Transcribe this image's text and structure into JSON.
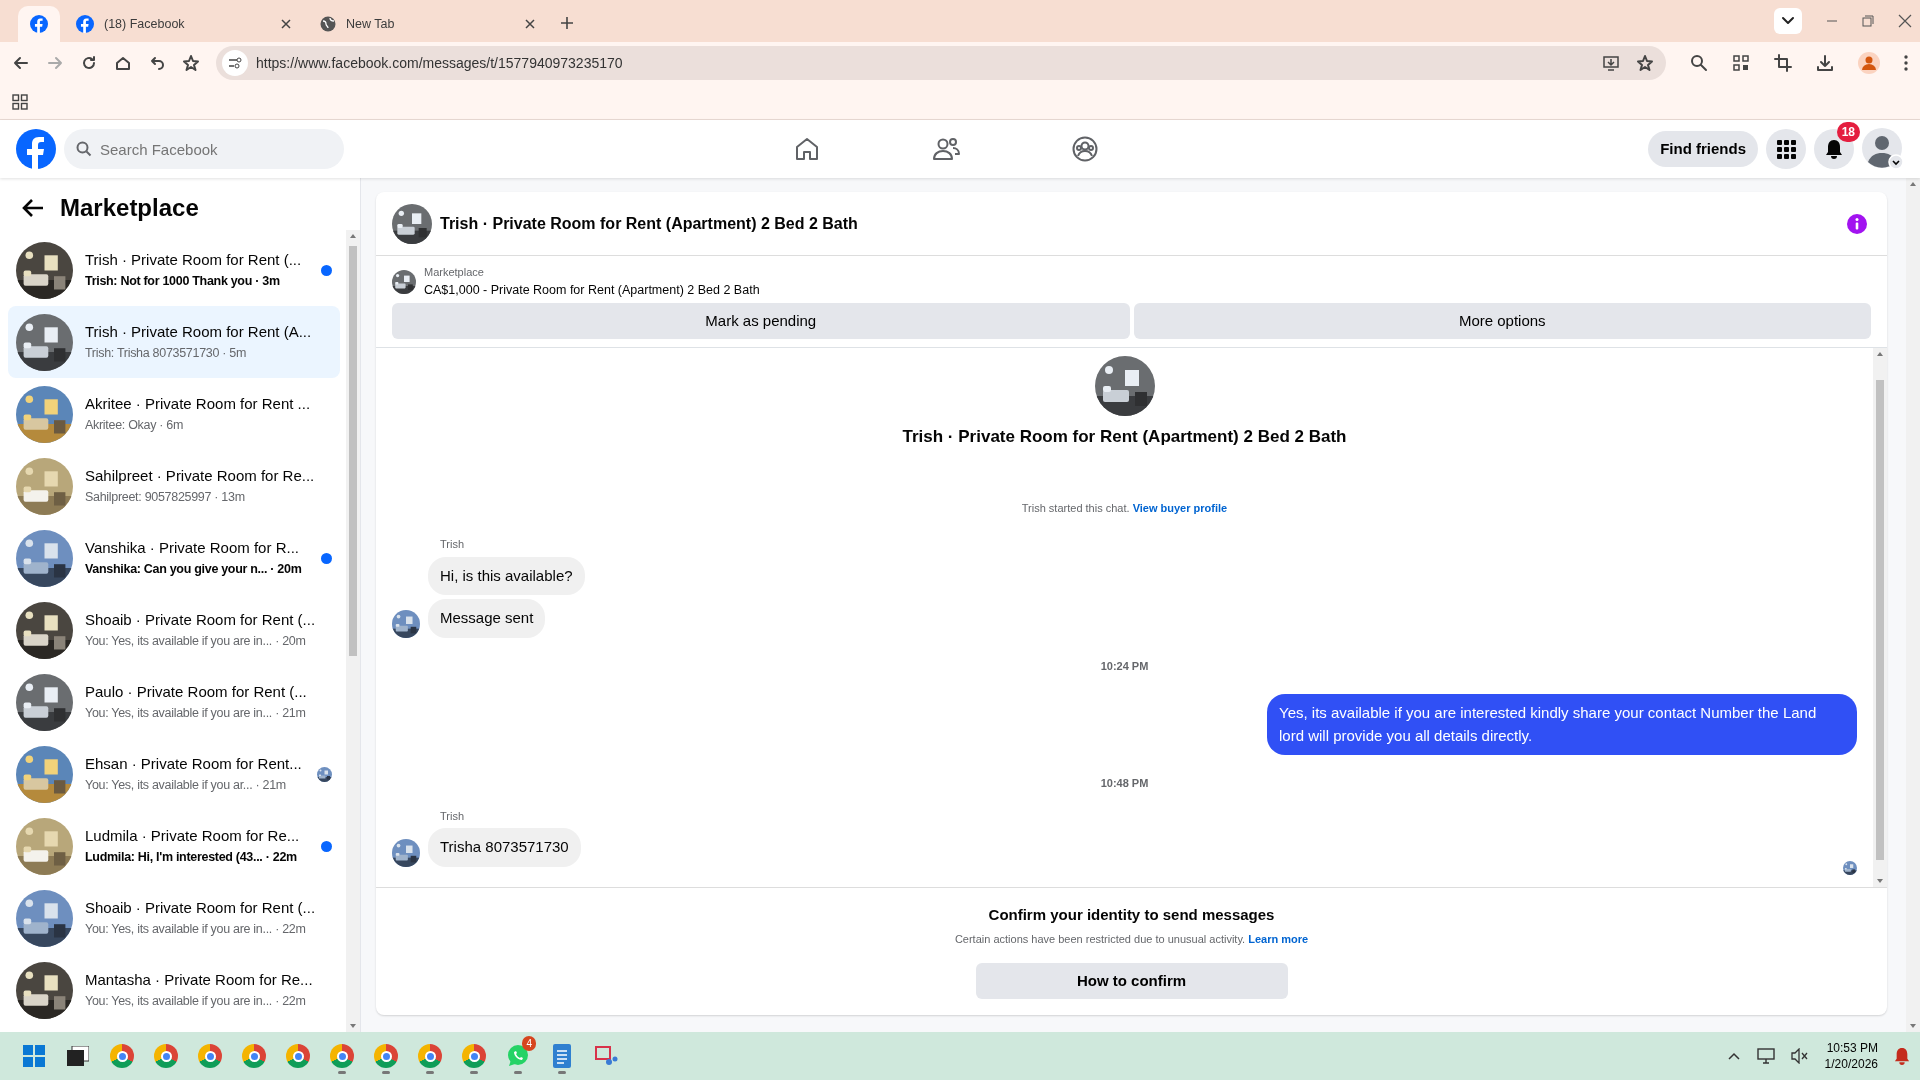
{
  "browser": {
    "tabs": [
      {
        "kind": "pinned",
        "selected": true
      },
      {
        "kind": "normal",
        "title": "(18) Facebook",
        "selected": false
      },
      {
        "kind": "normal",
        "title": "New Tab",
        "selected": false
      }
    ],
    "url": "https://www.facebook.com/messages/t/1577940973235170"
  },
  "header": {
    "search": {
      "placeholder": "Search Facebook"
    },
    "find_friends": "Find friends",
    "notifications": "18"
  },
  "sidebar": {
    "title": "Marketplace",
    "conversations": [
      {
        "title": "Trish · Private Room for Rent (...",
        "preview": "Trish: Not for 1000 Thank you",
        "time": "· 3m",
        "unread": true,
        "seen": false,
        "selected": false
      },
      {
        "title": "Trish · Private Room for Rent (A...",
        "preview": "Trish: Trisha 8073571730",
        "time": "· 5m",
        "unread": false,
        "seen": false,
        "selected": true
      },
      {
        "title": "Akritee · Private Room for Rent ...",
        "preview": "Akritee: Okay",
        "time": "· 6m",
        "unread": false,
        "seen": false,
        "selected": false
      },
      {
        "title": "Sahilpreet · Private Room for Re...",
        "preview": "Sahilpreet: 9057825997",
        "time": "· 13m",
        "unread": false,
        "seen": false,
        "selected": false
      },
      {
        "title": "Vanshika · Private Room for R...",
        "preview": "Vanshika: Can you give your n...",
        "time": "· 20m",
        "unread": true,
        "seen": false,
        "selected": false
      },
      {
        "title": "Shoaib · Private Room for Rent (...",
        "preview": "You: Yes, its available if you are in...",
        "time": "· 20m",
        "unread": false,
        "seen": false,
        "selected": false
      },
      {
        "title": "Paulo · Private Room for Rent (...",
        "preview": "You: Yes, its available if you are in...",
        "time": "· 21m",
        "unread": false,
        "seen": false,
        "selected": false
      },
      {
        "title": "Ehsan · Private Room for Rent...",
        "preview": "You: Yes, its available if you ar...",
        "time": "· 21m",
        "unread": false,
        "seen": true,
        "selected": false
      },
      {
        "title": "Ludmila · Private Room for Re...",
        "preview": "Ludmila: Hi, I'm interested (43...",
        "time": "· 22m",
        "unread": true,
        "seen": false,
        "selected": false
      },
      {
        "title": "Shoaib · Private Room for Rent (...",
        "preview": "You: Yes, its available if you are in...",
        "time": "· 22m",
        "unread": false,
        "seen": false,
        "selected": false
      },
      {
        "title": "Mantasha · Private Room for Re...",
        "preview": "You: Yes, its available if you are in...",
        "time": "· 22m",
        "unread": false,
        "seen": false,
        "selected": false
      }
    ]
  },
  "chat": {
    "title": "Trish · Private Room for Rent (Apartment) 2 Bed 2 Bath",
    "listing": {
      "label": "Marketplace",
      "text": "CA$1,000 - Private Room for Rent (Apartment) 2 Bed 2 Bath",
      "buttons": [
        "Mark as pending",
        "More options"
      ]
    },
    "profile_title": "Trish · Private Room for Rent (Apartment) 2 Bed 2 Bath",
    "started": {
      "text": "Trish started this chat.",
      "link": "View buyer profile"
    },
    "messages": [
      {
        "kind": "sender",
        "text": "Trish"
      },
      {
        "kind": "incoming",
        "text": "Hi, is this available?",
        "avatar": false
      },
      {
        "kind": "incoming",
        "text": "Message sent",
        "avatar": true
      },
      {
        "kind": "time",
        "text": "10:24 PM"
      },
      {
        "kind": "outgoing",
        "text": "Yes, its available if you are interested kindly share your contact Number the Land lord will provide you all details directly."
      },
      {
        "kind": "time",
        "text": "10:48 PM"
      },
      {
        "kind": "sender",
        "text": "Trish"
      },
      {
        "kind": "incoming",
        "text": "Trisha 8073571730",
        "avatar": true
      },
      {
        "kind": "seen"
      }
    ],
    "footer": {
      "title": "Confirm your identity to send messages",
      "text": "Certain actions have been restricted due to unusual activity.",
      "link": "Learn more",
      "button": "How to confirm"
    }
  },
  "taskbar": {
    "apps": [
      {
        "kind": "start",
        "running": false
      },
      {
        "kind": "explorer",
        "running": false
      },
      {
        "kind": "chrome",
        "running": false
      },
      {
        "kind": "chrome",
        "running": false
      },
      {
        "kind": "chrome",
        "running": false
      },
      {
        "kind": "chrome",
        "running": false
      },
      {
        "kind": "chrome",
        "running": false
      },
      {
        "kind": "chrome",
        "running": true
      },
      {
        "kind": "chrome",
        "running": true
      },
      {
        "kind": "chrome",
        "running": true
      },
      {
        "kind": "chrome",
        "running": true
      },
      {
        "kind": "whatsapp",
        "running": true,
        "badge": "4"
      },
      {
        "kind": "notepad",
        "running": true
      },
      {
        "kind": "snip",
        "running": false
      }
    ],
    "time": "10:53 PM",
    "date": "1/20/2026"
  }
}
